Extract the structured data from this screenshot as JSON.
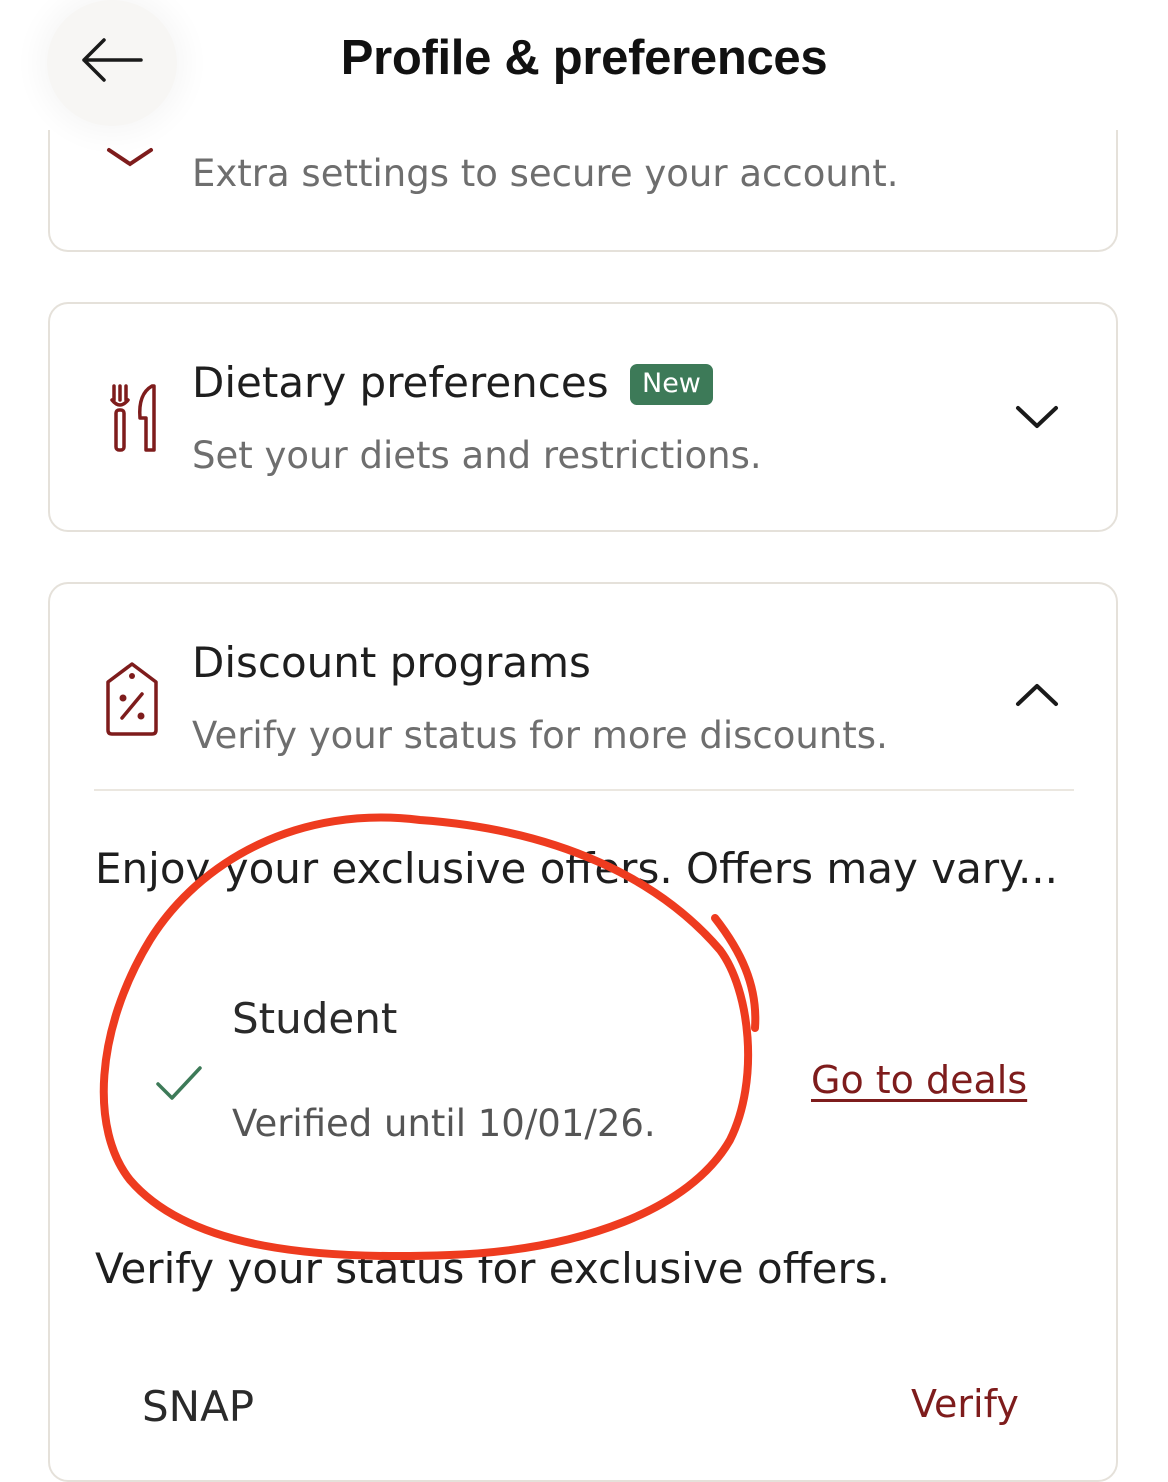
{
  "header": {
    "title": "Profile & preferences"
  },
  "security_card": {
    "subtitle": "Extra settings to secure your account."
  },
  "dietary_card": {
    "title": "Dietary preferences",
    "badge": "New",
    "subtitle": "Set your diets and restrictions."
  },
  "discount_card": {
    "title": "Discount programs",
    "subtitle": "Verify your status for more discounts.",
    "exclusive_text": "Enjoy your exclusive offers. Offers may vary...",
    "student": {
      "title": "Student",
      "status": "Verified until 10/01/26.",
      "link": "Go to deals"
    },
    "verify_prompt": "Verify your status for exclusive offers.",
    "snap": {
      "title": "SNAP",
      "link": "Verify"
    }
  },
  "colors": {
    "accent": "#7e1c1c",
    "badge": "#3d7a58",
    "check": "#3d7a58",
    "annotation": "#ee3b1f"
  },
  "icons": [
    "back-arrow-icon",
    "chevron-down-icon",
    "utensils-icon",
    "discount-tag-icon",
    "chevron-up-icon",
    "check-icon"
  ]
}
